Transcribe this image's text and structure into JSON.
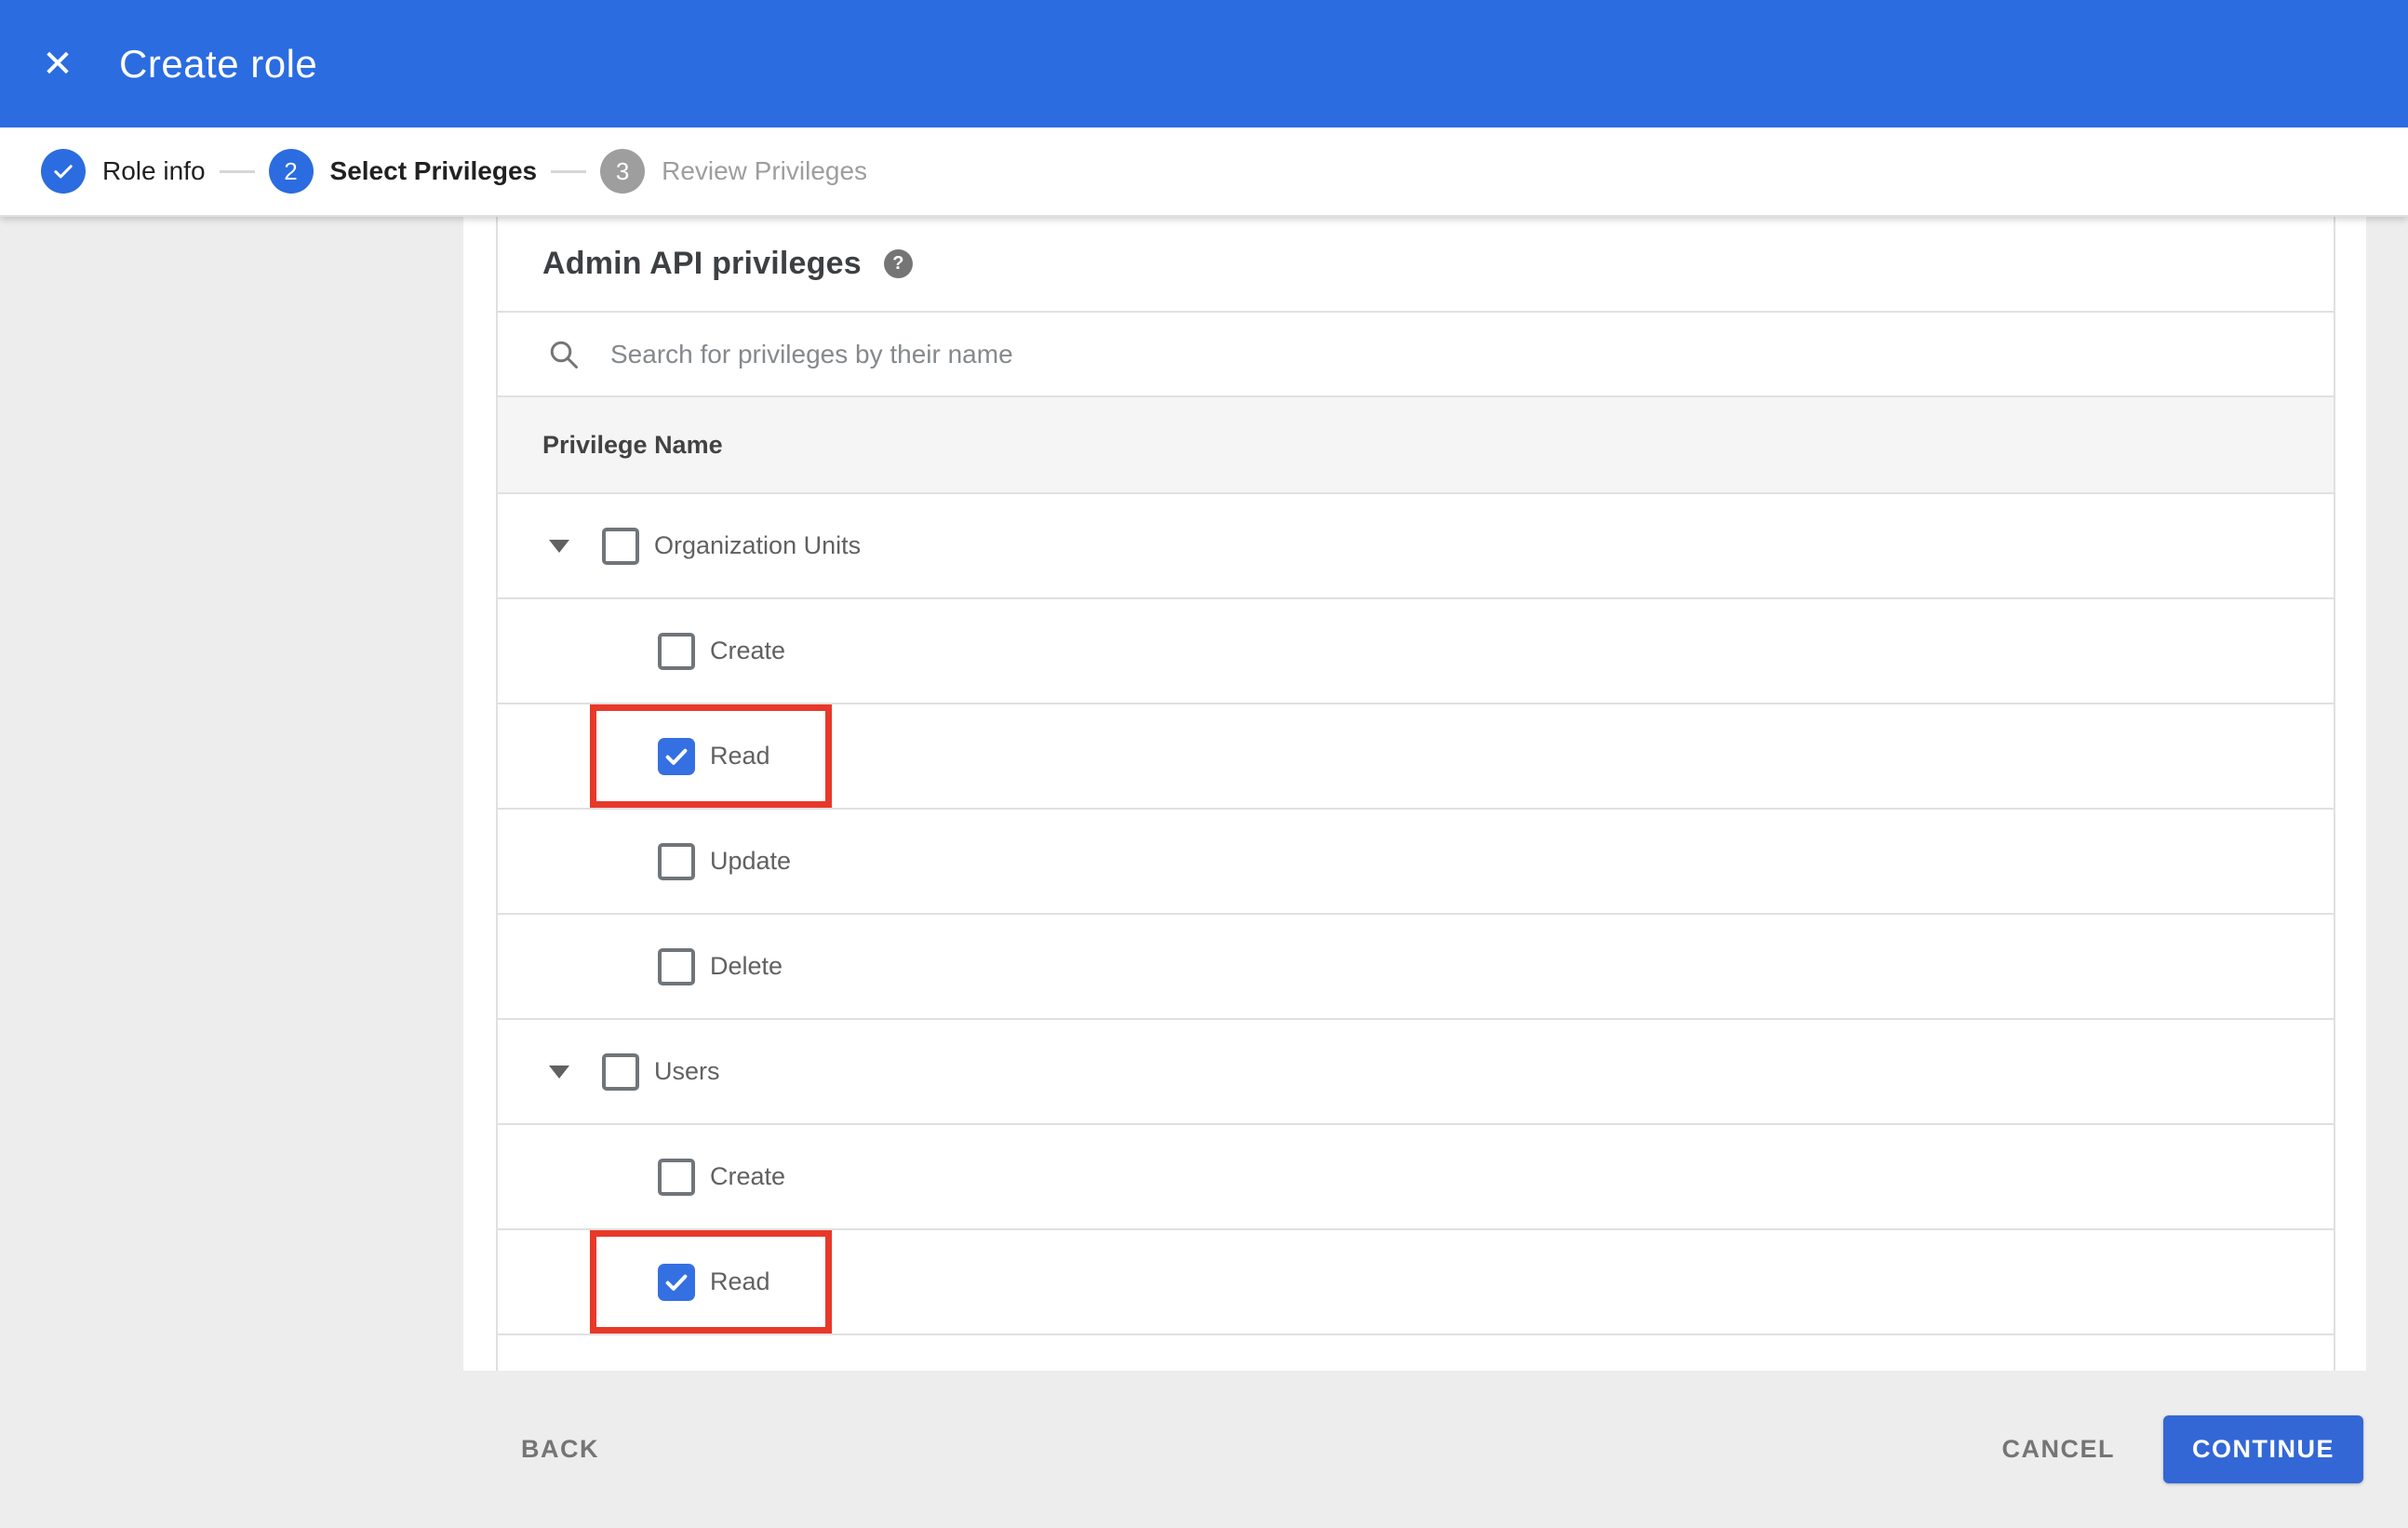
{
  "topbar": {
    "title": "Create role",
    "close_glyph": "✕"
  },
  "stepper": {
    "steps": [
      {
        "label": "Role info",
        "indicator": "check",
        "status": "done"
      },
      {
        "label": "Select Privileges",
        "indicator": "2",
        "status": "current"
      },
      {
        "label": "Review Privileges",
        "indicator": "3",
        "status": "upcoming"
      }
    ]
  },
  "privileges": {
    "heading": "Admin API privileges",
    "help_glyph": "?",
    "search_placeholder": "Search for privileges by their name",
    "column_header": "Privilege Name",
    "rows": [
      {
        "label": "Organization Units",
        "type": "parent",
        "checked": false,
        "highlighted": false
      },
      {
        "label": "Create",
        "type": "child",
        "checked": false,
        "highlighted": false
      },
      {
        "label": "Read",
        "type": "child",
        "checked": true,
        "highlighted": true
      },
      {
        "label": "Update",
        "type": "child",
        "checked": false,
        "highlighted": false
      },
      {
        "label": "Delete",
        "type": "child",
        "checked": false,
        "highlighted": false
      },
      {
        "label": "Users",
        "type": "parent",
        "checked": false,
        "highlighted": false
      },
      {
        "label": "Create",
        "type": "child",
        "checked": false,
        "highlighted": false
      },
      {
        "label": "Read",
        "type": "child",
        "checked": true,
        "highlighted": true
      }
    ]
  },
  "footer": {
    "back_label": "BACK",
    "cancel_label": "CANCEL",
    "continue_label": "CONTINUE"
  },
  "colors": {
    "accent_blue": "#2b6ce0",
    "checkbox_blue": "#3470e2",
    "button_blue": "#3367d6",
    "highlight_red": "#e8382a",
    "page_bg": "#ededed",
    "band_bg": "#f5f5f5",
    "divider": "#e0e0e0",
    "text_dark": "#212121",
    "text_gray": "#616161",
    "label_gray": "#757575",
    "muted": "#9e9e9e"
  }
}
